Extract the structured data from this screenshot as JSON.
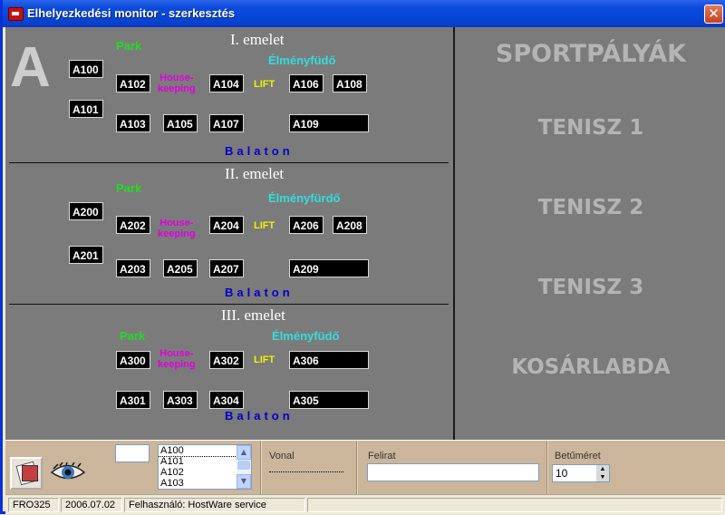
{
  "window": {
    "title": "Elhelyezkedési monitor - szerkesztés",
    "close": "✕"
  },
  "monitor": {
    "building": "A",
    "labels": {
      "park": "Park",
      "spa": "Élményfüdő",
      "spa2": "Élményfürdő",
      "hk1": "House-",
      "hk2": "keeping",
      "lift": "LIFT",
      "balaton": "Balaton"
    },
    "floors": [
      {
        "title": "I. emelet",
        "rooms": [
          "A100",
          "A101",
          "A102",
          "A103",
          "A104",
          "A105",
          "A106",
          "A107",
          "A108",
          "A109"
        ]
      },
      {
        "title": "II. emelet",
        "rooms": [
          "A200",
          "A201",
          "A202",
          "A203",
          "A204",
          "A205",
          "A206",
          "A207",
          "A208",
          "A209"
        ]
      },
      {
        "title": "III. emelet",
        "rooms": [
          "A300",
          "A301",
          "A302",
          "A303",
          "A304",
          "A305",
          "A306"
        ]
      }
    ]
  },
  "sports": {
    "title": "SPORTPÁLYÁK",
    "items": [
      "TENISZ 1",
      "TENISZ 2",
      "TENISZ 3",
      "KOSÁRLABDA"
    ]
  },
  "toolbar": {
    "list_items": [
      "A100",
      "A101",
      "A102",
      "A103"
    ],
    "vonal_label": "Vonal",
    "felirat_label": "Felirat",
    "felirat_value": "",
    "betumeret_label": "Betűméret",
    "betumeret_value": "10"
  },
  "status": {
    "code": "FRO325",
    "date": "2006.07.02",
    "user": "Felhasználó: HostWare service"
  }
}
